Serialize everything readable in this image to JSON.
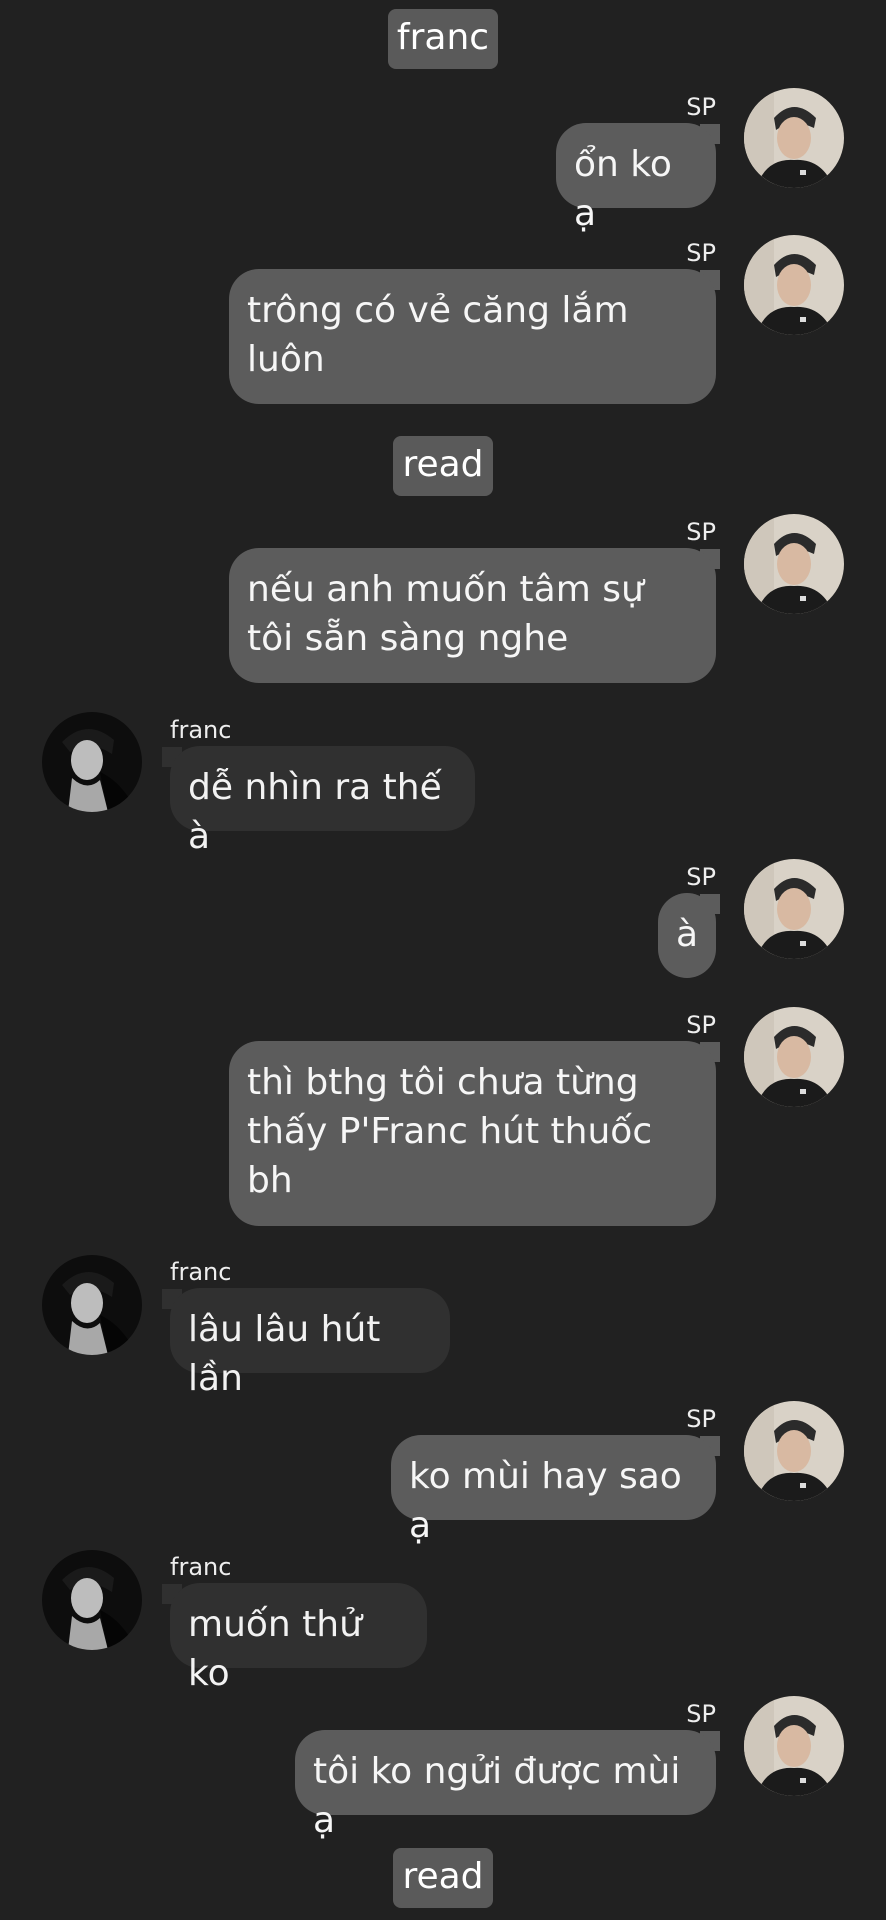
{
  "system_labels": {
    "top": "franc",
    "read_1": "read",
    "read_2": "read"
  },
  "contacts": {
    "me": {
      "name": "SP"
    },
    "other": {
      "name": "franc"
    }
  },
  "messages": [
    {
      "sender": "SP",
      "text": "ổn ko ạ"
    },
    {
      "sender": "SP",
      "text": "trông có vẻ căng lắm luôn"
    },
    {
      "sender": "SP",
      "text": "nếu anh muốn tâm sự tôi sẵn sàng nghe"
    },
    {
      "sender": "franc",
      "text": "dễ nhìn ra thế à"
    },
    {
      "sender": "SP",
      "text": "à"
    },
    {
      "sender": "SP",
      "text": "thì bthg tôi chưa từng thấy P'Franc hút thuốc bh"
    },
    {
      "sender": "franc",
      "text": "lâu lâu hút lần"
    },
    {
      "sender": "SP",
      "text": "ko mùi hay sao ạ"
    },
    {
      "sender": "franc",
      "text": "muốn thử ko"
    },
    {
      "sender": "SP",
      "text": "tôi ko ngửi được mùi ạ"
    }
  ]
}
